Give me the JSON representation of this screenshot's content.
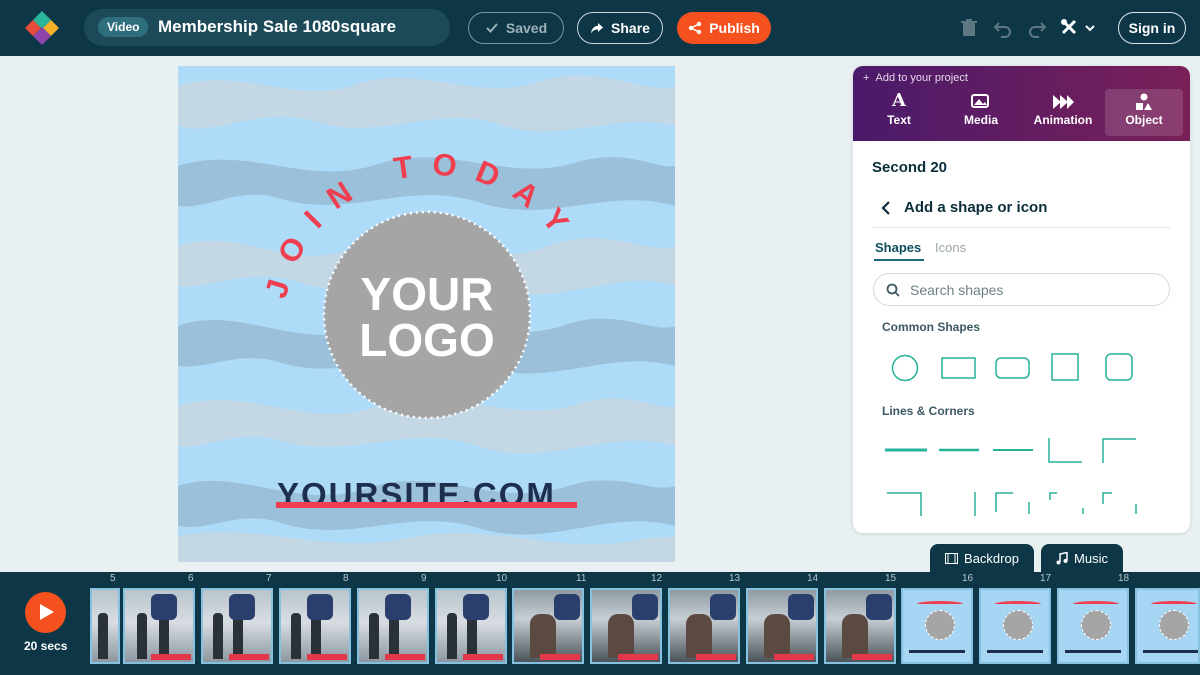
{
  "header": {
    "badge": "Video",
    "doc_title": "Membership Sale 1080square",
    "saved_label": "Saved",
    "share_label": "Share",
    "publish_label": "Publish",
    "signin_label": "Sign in"
  },
  "canvas": {
    "arc_text": "JOIN TODAY",
    "logo_line1": "YOUR",
    "logo_line2": "LOGO",
    "site_text": "YOURSITE.COM"
  },
  "panel": {
    "add_label": "Add to your project",
    "tabs": [
      {
        "label": "Text",
        "icon": "text-icon"
      },
      {
        "label": "Media",
        "icon": "media-icon"
      },
      {
        "label": "Animation",
        "icon": "animation-icon"
      },
      {
        "label": "Object",
        "icon": "object-icon"
      }
    ],
    "active_tab": "Object",
    "section_title": "Second 20",
    "subtitle": "Add a shape or icon",
    "subtabs": [
      "Shapes",
      "Icons"
    ],
    "search_placeholder": "Search shapes",
    "common_shapes_heading": "Common Shapes",
    "lines_heading": "Lines & Corners"
  },
  "bottom_tabs": {
    "backdrop": "Backdrop",
    "music": "Music"
  },
  "timeline": {
    "duration": "20 secs",
    "ticks": [
      "5",
      "6",
      "7",
      "8",
      "9",
      "10",
      "11",
      "12",
      "13",
      "14",
      "15",
      "16",
      "17",
      "18"
    ],
    "thumbnail_labels": [
      "YOUR",
      "LOGO",
      "YOURSITE.COM"
    ]
  },
  "colors": {
    "header_bg": "#0d3746",
    "accent": "#f4511e",
    "shape_teal": "#27b29a",
    "canvas_bg": "#aedbf8",
    "arc_text": "#ef3e4f"
  }
}
